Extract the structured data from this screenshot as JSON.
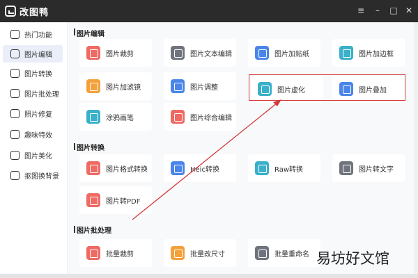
{
  "titlebar": {
    "title": "改图鸭"
  },
  "sidebar": {
    "items": [
      {
        "label": "热门功能",
        "icon": "fire-icon",
        "active": false
      },
      {
        "label": "图片编辑",
        "icon": "image-edit-icon",
        "active": true
      },
      {
        "label": "图片转换",
        "icon": "convert-icon",
        "active": false
      },
      {
        "label": "图片批处理",
        "icon": "batch-icon",
        "active": false
      },
      {
        "label": "照片修复",
        "icon": "repair-icon",
        "active": false
      },
      {
        "label": "趣味特效",
        "icon": "effects-icon",
        "active": false
      },
      {
        "label": "图片美化",
        "icon": "beautify-icon",
        "active": false
      },
      {
        "label": "抠图换背景",
        "icon": "cutout-icon",
        "active": false
      }
    ]
  },
  "sections": [
    {
      "title": "图片编辑",
      "items": [
        {
          "label": "图片裁剪",
          "icon": "crop-icon",
          "color": "red"
        },
        {
          "label": "图片文本编辑",
          "icon": "text-icon",
          "color": "gray"
        },
        {
          "label": "图片加贴纸",
          "icon": "sticker-icon",
          "color": "blue"
        },
        {
          "label": "图片加边框",
          "icon": "frame-icon",
          "color": "teal"
        },
        {
          "label": "图片加滤镜",
          "icon": "filter-icon",
          "color": "orange"
        },
        {
          "label": "图片调整",
          "icon": "adjust-icon",
          "color": "blue"
        },
        {
          "label": "图片虚化",
          "icon": "blur-icon",
          "color": "teal"
        },
        {
          "label": "图片叠加",
          "icon": "layers-icon",
          "color": "blue"
        },
        {
          "label": "涂鸦画笔",
          "icon": "brush-icon",
          "color": "teal"
        },
        {
          "label": "图片综合编辑",
          "icon": "combo-edit-icon",
          "color": "red"
        }
      ]
    },
    {
      "title": "图片转换",
      "items": [
        {
          "label": "图片格式转换",
          "icon": "format-icon",
          "color": "red"
        },
        {
          "label": "Heic转换",
          "icon": "heic-icon",
          "color": "blue"
        },
        {
          "label": "Raw转换",
          "icon": "raw-icon",
          "color": "teal"
        },
        {
          "label": "图片转文字",
          "icon": "ocr-icon",
          "color": "gray"
        },
        {
          "label": "图片转PDF",
          "icon": "pdf-icon",
          "color": "red"
        }
      ]
    },
    {
      "title": "图片批处理",
      "items": [
        {
          "label": "批量裁剪",
          "icon": "batch-crop-icon",
          "color": "red"
        },
        {
          "label": "批量改尺寸",
          "icon": "batch-resize-icon",
          "color": "orange"
        },
        {
          "label": "批量重命名",
          "icon": "batch-rename-icon",
          "color": "gray"
        }
      ]
    }
  ],
  "watermark": "易坊好文馆",
  "colors": {
    "titlebar": "#2b2b2b",
    "highlight": "#d23a3a",
    "active_bg": "#e9eef9"
  }
}
